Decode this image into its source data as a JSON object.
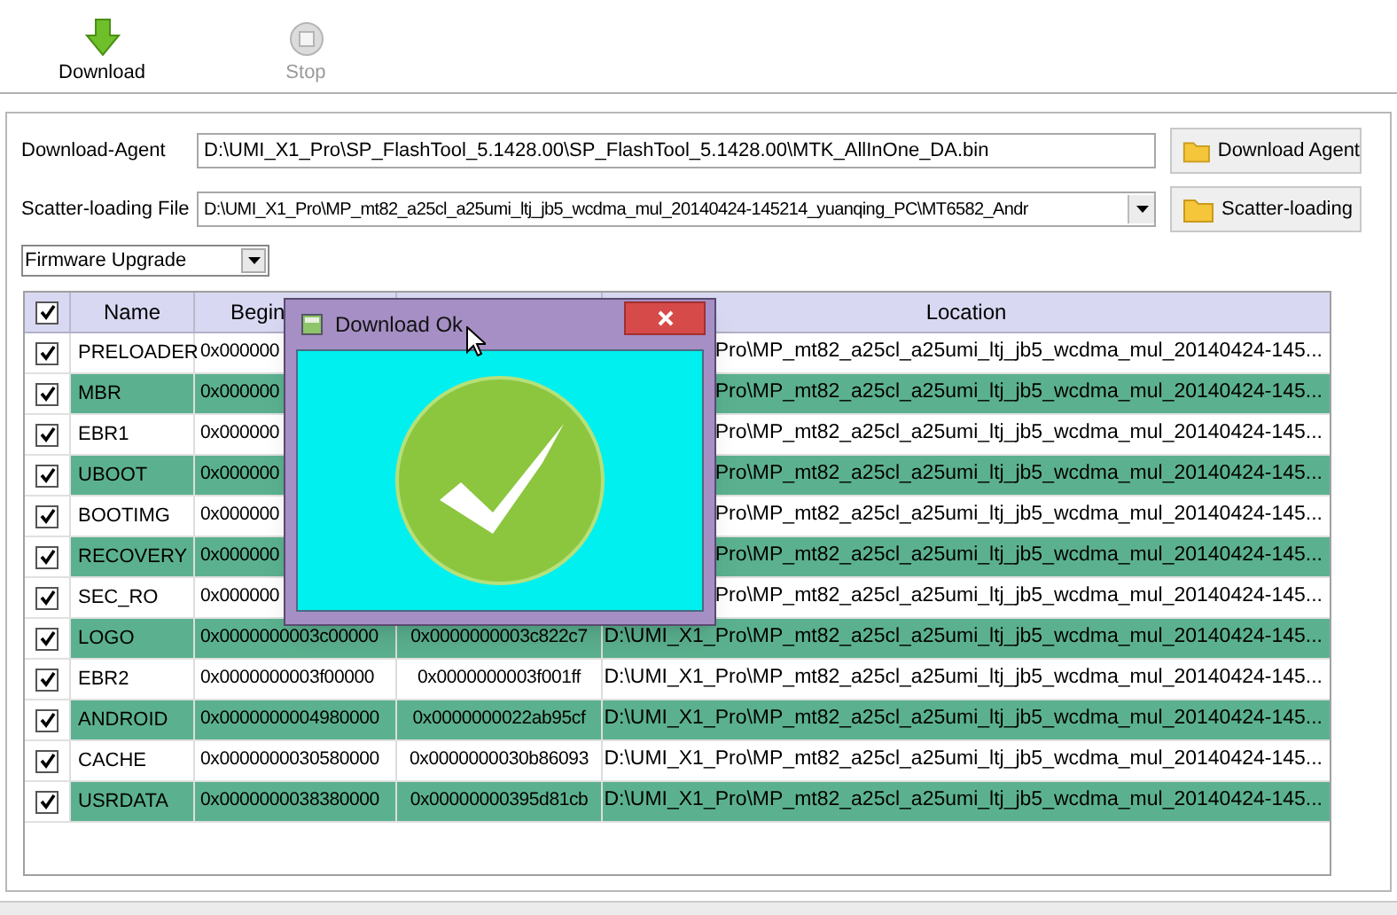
{
  "toolbar": [
    {
      "label": "Download",
      "disabled": false
    },
    {
      "label": "Stop",
      "disabled": true
    }
  ],
  "download_agent": {
    "label": "Download-Agent",
    "value": "D:\\UMI_X1_Pro\\SP_FlashTool_5.1428.00\\SP_FlashTool_5.1428.00\\MTK_AllInOne_DA.bin",
    "button": "Download Agent"
  },
  "scatter_file": {
    "label": "Scatter-loading File",
    "value": "D:\\UMI_X1_Pro\\MP_mt82_a25cl_a25umi_ltj_jb5_wcdma_mul_20140424-145214_yuanqing_PC\\MT6582_Andr",
    "button": "Scatter-loading"
  },
  "mode": {
    "value": "Firmware Upgrade"
  },
  "table": {
    "all_checked": true,
    "columns": {
      "name": "Name",
      "begin": "Begin",
      "location": "Location"
    },
    "rows": [
      {
        "checked": true,
        "name": "PRELOADER",
        "begin": "0x000000",
        "location": "Pro\\MP_mt82_a25cl_a25umi_ltj_jb5_wcdma_mul_20140424-145..."
      },
      {
        "checked": true,
        "name": "MBR",
        "begin": "0x000000",
        "location": "Pro\\MP_mt82_a25cl_a25umi_ltj_jb5_wcdma_mul_20140424-145..."
      },
      {
        "checked": true,
        "name": "EBR1",
        "begin": "0x000000",
        "location": "Pro\\MP_mt82_a25cl_a25umi_ltj_jb5_wcdma_mul_20140424-145..."
      },
      {
        "checked": true,
        "name": "UBOOT",
        "begin": "0x000000",
        "location": "Pro\\MP_mt82_a25cl_a25umi_ltj_jb5_wcdma_mul_20140424-145..."
      },
      {
        "checked": true,
        "name": "BOOTIMG",
        "begin": "0x000000",
        "location": "Pro\\MP_mt82_a25cl_a25umi_ltj_jb5_wcdma_mul_20140424-145..."
      },
      {
        "checked": true,
        "name": "RECOVERY",
        "begin": "0x000000",
        "location": "Pro\\MP_mt82_a25cl_a25umi_ltj_jb5_wcdma_mul_20140424-145..."
      },
      {
        "checked": true,
        "name": "SEC_RO",
        "begin": "0x000000",
        "location": "Pro\\MP_mt82_a25cl_a25umi_ltj_jb5_wcdma_mul_20140424-145..."
      },
      {
        "checked": true,
        "name": "LOGO",
        "begin": "0x0000000003c00000",
        "end": "0x0000000003c822c7",
        "location": "D:\\UMI_X1_Pro\\MP_mt82_a25cl_a25umi_ltj_jb5_wcdma_mul_20140424-145..."
      },
      {
        "checked": true,
        "name": "EBR2",
        "begin": "0x0000000003f00000",
        "end": "0x0000000003f001ff",
        "location": "D:\\UMI_X1_Pro\\MP_mt82_a25cl_a25umi_ltj_jb5_wcdma_mul_20140424-145..."
      },
      {
        "checked": true,
        "name": "ANDROID",
        "begin": "0x0000000004980000",
        "end": "0x0000000022ab95cf",
        "location": "D:\\UMI_X1_Pro\\MP_mt82_a25cl_a25umi_ltj_jb5_wcdma_mul_20140424-145..."
      },
      {
        "checked": true,
        "name": "CACHE",
        "begin": "0x0000000030580000",
        "end": "0x0000000030b86093",
        "location": "D:\\UMI_X1_Pro\\MP_mt82_a25cl_a25umi_ltj_jb5_wcdma_mul_20140424-145..."
      },
      {
        "checked": true,
        "name": "USRDATA",
        "begin": "0x0000000038380000",
        "end": "0x00000000395d81cb",
        "location": "D:\\UMI_X1_Pro\\MP_mt82_a25cl_a25umi_ltj_jb5_wcdma_mul_20140424-145..."
      }
    ]
  },
  "dialog": {
    "title": "Download Ok"
  }
}
